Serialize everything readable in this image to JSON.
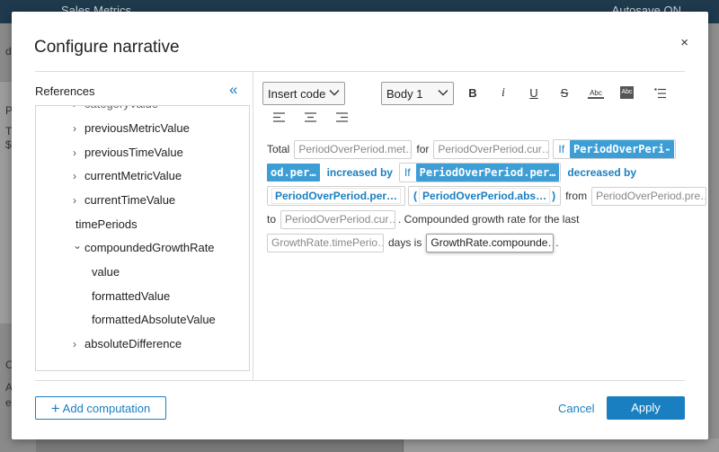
{
  "background": {
    "title": "Sales Metrics",
    "autosave": "Autosave ON",
    "left_fragments": [
      "d",
      "P",
      "T",
      "$",
      "C",
      "A",
      "e"
    ]
  },
  "modal": {
    "title": "Configure narrative",
    "close": "×"
  },
  "references": {
    "header": "References",
    "collapse": "«",
    "items": [
      {
        "label": "categoryValue",
        "chevron": "›"
      },
      {
        "label": "previousMetricValue",
        "chevron": "›"
      },
      {
        "label": "previousTimeValue",
        "chevron": "›"
      },
      {
        "label": "currentMetricValue",
        "chevron": "›"
      },
      {
        "label": "currentTimeValue",
        "chevron": "›"
      },
      {
        "label": "timePeriods",
        "chevron": ""
      },
      {
        "label": "compoundedGrowthRate",
        "chevron": "⌄"
      },
      {
        "label": "value",
        "chevron": ""
      },
      {
        "label": "formattedValue",
        "chevron": ""
      },
      {
        "label": "formattedAbsoluteValue",
        "chevron": ""
      },
      {
        "label": "absoluteDifference",
        "chevron": "›"
      }
    ]
  },
  "toolbar": {
    "insert_code": "Insert code",
    "style": "Body 1",
    "bold": "B",
    "italic": "i",
    "underline": "U",
    "strike": "S",
    "font_color": "Abc",
    "bg_color": "Abc"
  },
  "narrative": {
    "l1_total": "Total",
    "l1_tok1": "PeriodOverPeriod.met…",
    "l1_for": "for",
    "l1_tok2": "PeriodOverPeriod.cur…",
    "if1": "If",
    "l1_hl": "PeriodOverPeri-",
    "l2_hl": "od.per…",
    "increased": "increased by",
    "if2": "If",
    "l2_hl2": "PeriodOverPeriod.per…",
    "decreased": "decreased by",
    "l3_tok1": "PeriodOverPeriod.per…",
    "l3_paren_open": "(",
    "l3_tok2": "PeriodOverPeriod.abs…",
    "l3_paren_close": ")",
    "l3_from": "from",
    "l3_tok3": "PeriodOverPeriod.pre…",
    "l4_to": "to",
    "l4_tok": "PeriodOverPeriod.cur…",
    "l4_text": ". Compounded growth rate for the last",
    "l5_tok1": "GrowthRate.timePerio…",
    "l5_days": "days is",
    "l5_tok2": "GrowthRate.compounde…",
    "l5_end": "."
  },
  "footer": {
    "add_computation": "Add computation",
    "add_icon": "+",
    "cancel": "Cancel",
    "apply": "Apply"
  }
}
